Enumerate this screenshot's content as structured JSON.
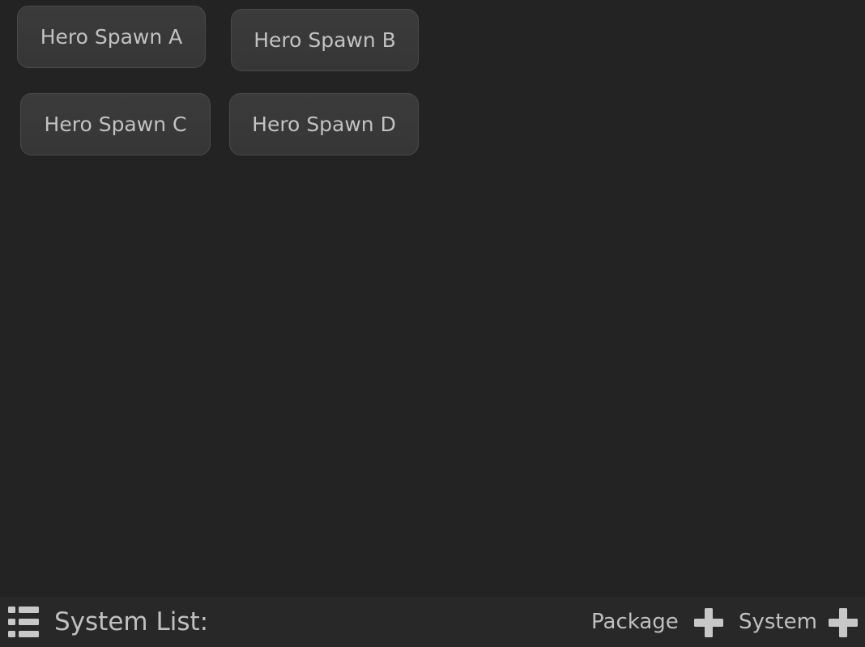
{
  "spawn_buttons": [
    {
      "label": "Hero Spawn A"
    },
    {
      "label": "Hero Spawn B"
    },
    {
      "label": "Hero Spawn C"
    },
    {
      "label": "Hero Spawn D"
    }
  ],
  "footer": {
    "list_icon": "list-icon",
    "system_list_label": "System List:",
    "package_label": "Package",
    "package_add_icon": "plus-icon",
    "system_label": "System",
    "system_add_icon": "plus-icon"
  },
  "colors": {
    "background": "#232323",
    "button_background": "#383838",
    "button_border": "#4a4a4a",
    "text": "#c2c2c2",
    "footer_background": "#282828"
  }
}
